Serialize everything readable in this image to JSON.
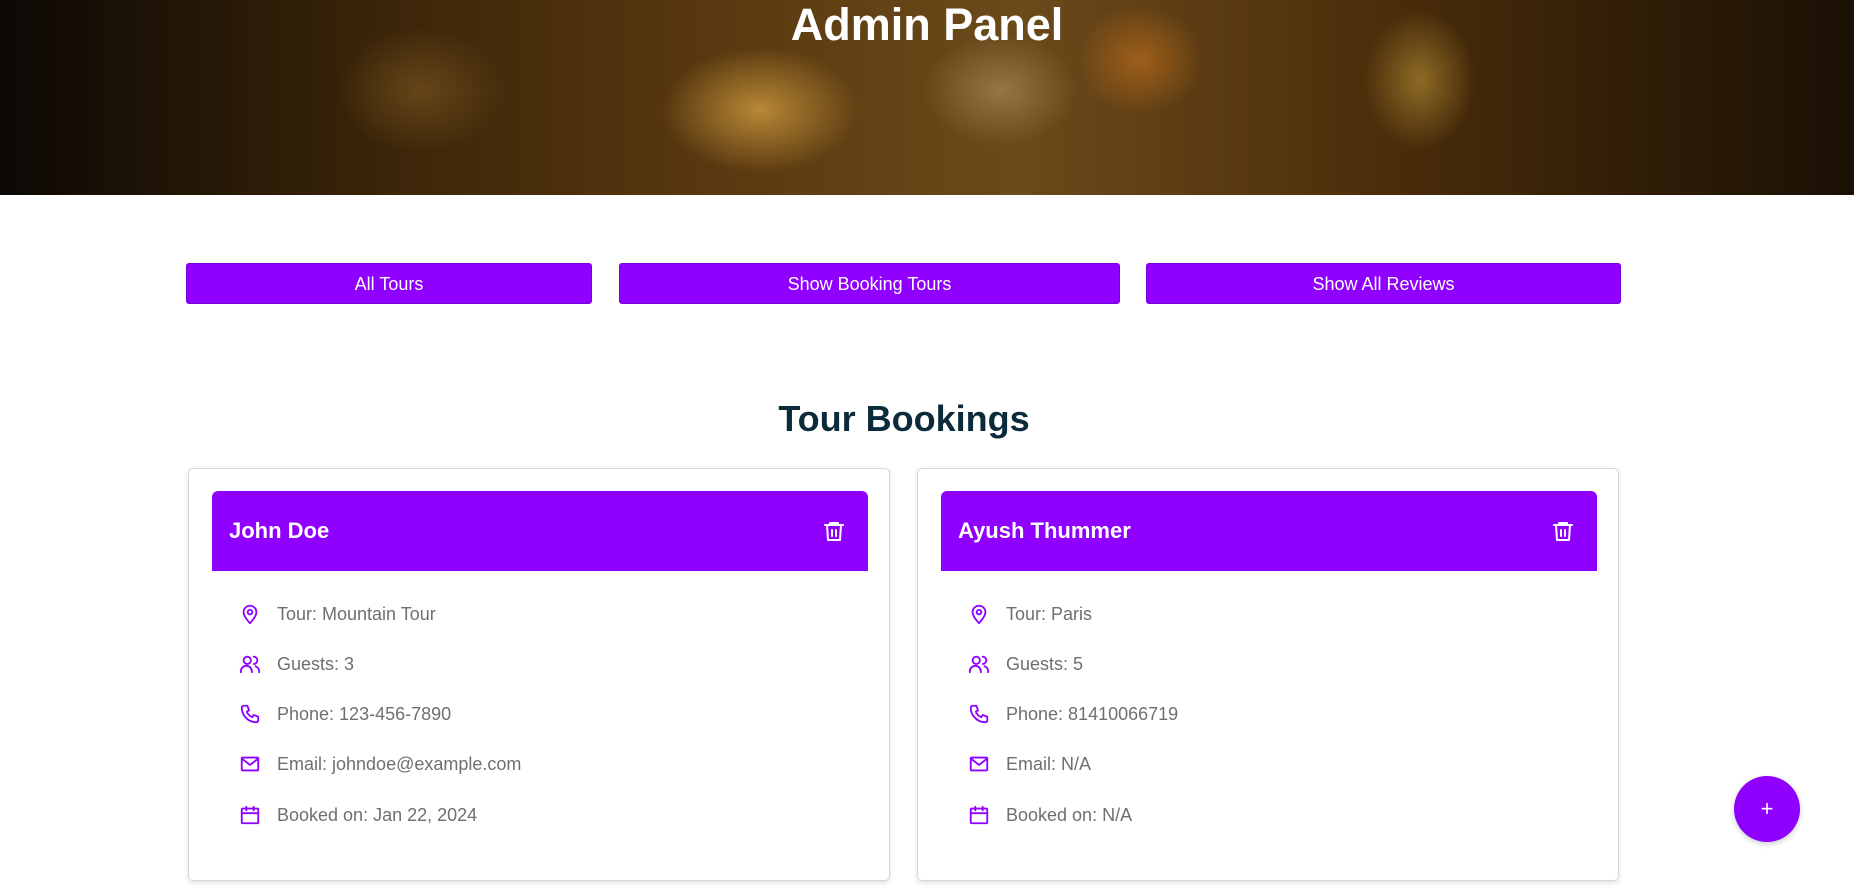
{
  "hero": {
    "title": "Admin Panel"
  },
  "nav": {
    "all_tours": "All Tours",
    "show_booking_tours": "Show Booking Tours",
    "show_all_reviews": "Show All Reviews"
  },
  "section": {
    "title": "Tour Bookings"
  },
  "bookings": [
    {
      "name": "John Doe",
      "tour": "Tour: Mountain Tour",
      "guests": "Guests: 3",
      "phone": "Phone: 123-456-7890",
      "email": "Email: johndoe@example.com",
      "booked_on": "Booked on: Jan 22, 2024"
    },
    {
      "name": "Ayush Thummer",
      "tour": "Tour: Paris",
      "guests": "Guests: 5",
      "phone": "Phone: 81410066719",
      "email": "Email: N/A",
      "booked_on": "Booked on: N/A"
    }
  ],
  "fab": {
    "label": "+"
  },
  "icons": {
    "tour": "map-pin-icon",
    "guests": "users-icon",
    "phone": "phone-icon",
    "email": "mail-icon",
    "booked_on": "calendar-icon",
    "delete": "trash-icon"
  },
  "colors": {
    "accent": "#8f00ff",
    "title": "#0c2b3a",
    "muted": "#6f6f6f"
  }
}
